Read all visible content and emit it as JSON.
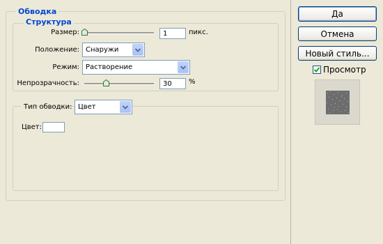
{
  "main_group": {
    "legend": "Обводка"
  },
  "structure_group": {
    "legend": "Структура",
    "size": {
      "label": "Размер:",
      "value": "1",
      "unit": "пикс.",
      "slider_fraction": 0.0
    },
    "position": {
      "label": "Положение:",
      "selected": "Снаружи"
    },
    "blend_mode": {
      "label": "Режим:",
      "selected": "Растворение"
    },
    "opacity": {
      "label": "Непрозрачность:",
      "value": "30",
      "unit": "%",
      "slider_fraction": 0.3
    }
  },
  "fill_group": {
    "fill_type": {
      "label": "Тип обводки:",
      "selected": "Цвет"
    },
    "color": {
      "label": "Цвет:",
      "value": "#ffffff"
    }
  },
  "buttons": {
    "ok": "Да",
    "cancel": "Отмена",
    "new_style": "Новый стиль..."
  },
  "preview": {
    "label": "Просмотр",
    "checked": true
  },
  "colors": {
    "accent_text": "#0046d5",
    "dialog_bg": "#ece9d8",
    "checkbox_check": "#21a121"
  }
}
